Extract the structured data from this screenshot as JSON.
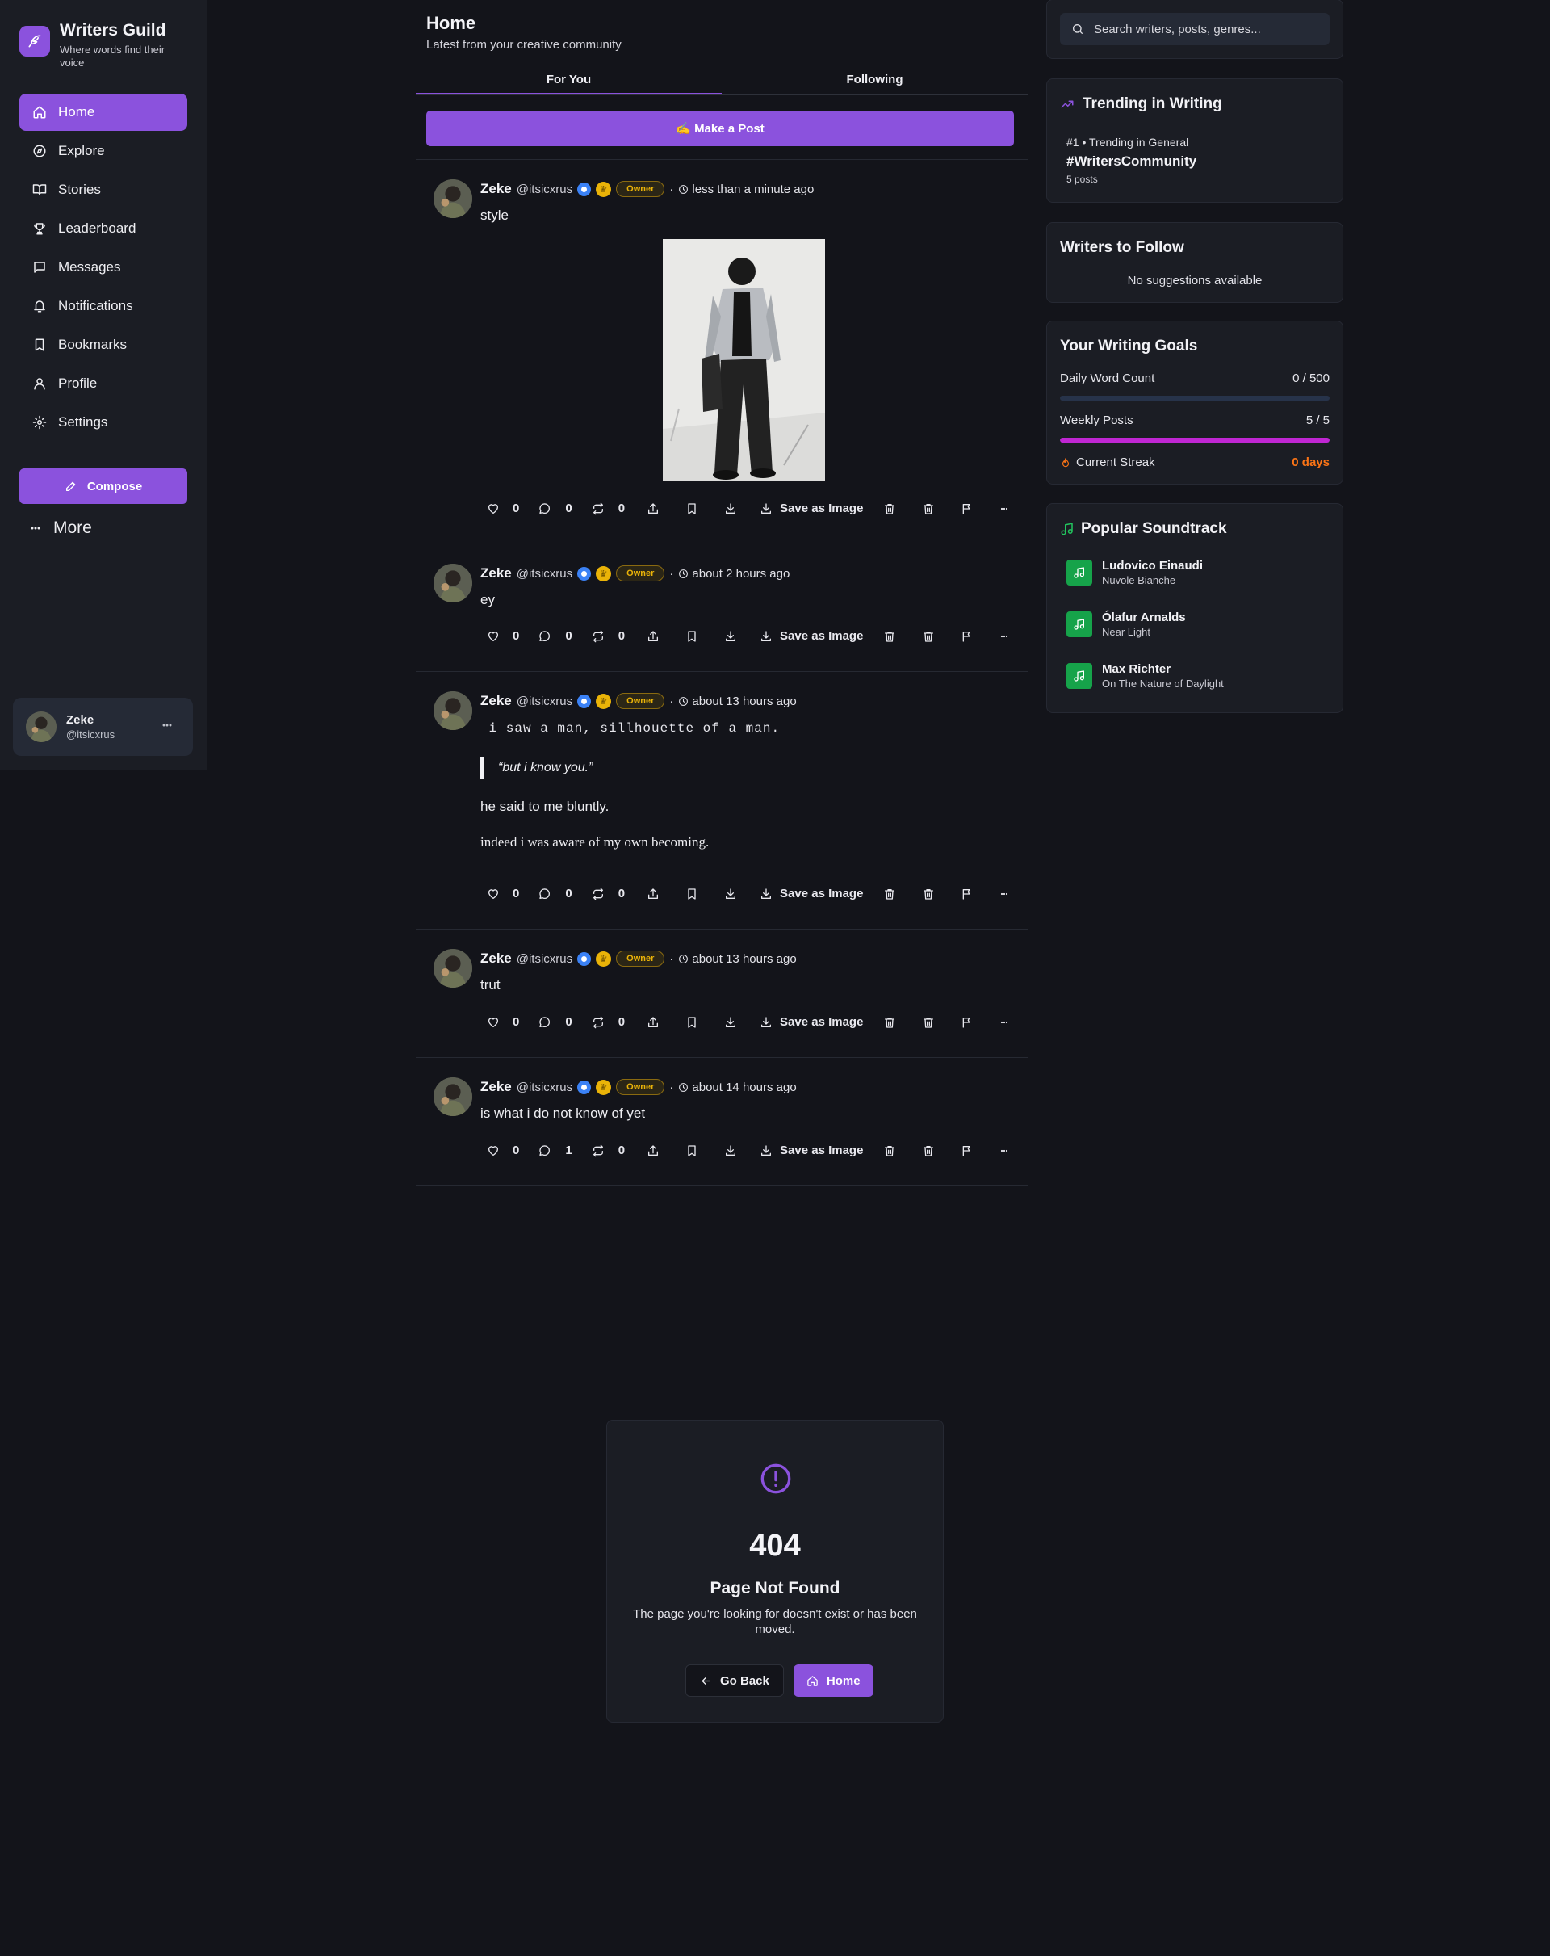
{
  "brand": {
    "name": "Writers Guild",
    "tagline": "Where words find their voice"
  },
  "nav": [
    {
      "label": "Home",
      "icon": "home-icon",
      "active": true
    },
    {
      "label": "Explore",
      "icon": "compass-icon"
    },
    {
      "label": "Stories",
      "icon": "book-icon"
    },
    {
      "label": "Leaderboard",
      "icon": "trophy-icon"
    },
    {
      "label": "Messages",
      "icon": "message-icon"
    },
    {
      "label": "Notifications",
      "icon": "bell-icon"
    },
    {
      "label": "Bookmarks",
      "icon": "bookmark-icon"
    },
    {
      "label": "Profile",
      "icon": "user-icon"
    },
    {
      "label": "Settings",
      "icon": "gear-icon"
    }
  ],
  "compose_label": "Compose",
  "more_label": "More",
  "current_user": {
    "name": "Zeke",
    "handle": "@itsicxrus"
  },
  "feed": {
    "title": "Home",
    "subtitle": "Latest from your creative community",
    "tabs": [
      "For You",
      "Following"
    ],
    "active_tab": "For You",
    "make_post_label": "✍️ Make a Post",
    "badge_label": "Owner",
    "save_label": "Save as Image"
  },
  "posts": [
    {
      "author": "Zeke",
      "handle": "@itsicxrus",
      "time": "less than a minute ago",
      "text": "style",
      "has_image": true,
      "likes": "0",
      "comments": "0",
      "reposts": "0"
    },
    {
      "author": "Zeke",
      "handle": "@itsicxrus",
      "time": "about 2 hours ago",
      "text": "ey",
      "likes": "0",
      "comments": "0",
      "reposts": "0"
    },
    {
      "author": "Zeke",
      "handle": "@itsicxrus",
      "time": "about 13 hours ago",
      "code_line": " i saw a man, sillhouette of a man.",
      "quote": "“but i know you.”",
      "line1": "he said to me bluntly.",
      "line2": "indeed i was aware of my own becoming.",
      "likes": "0",
      "comments": "0",
      "reposts": "0"
    },
    {
      "author": "Zeke",
      "handle": "@itsicxrus",
      "time": "about 13 hours ago",
      "text": "trut",
      "likes": "0",
      "comments": "0",
      "reposts": "0"
    },
    {
      "author": "Zeke",
      "handle": "@itsicxrus",
      "time": "about 14 hours ago",
      "text": "is what i do not know of yet",
      "likes": "0",
      "comments": "1",
      "reposts": "0"
    }
  ],
  "search": {
    "placeholder": "Search writers, posts, genres..."
  },
  "trending": {
    "title": "Trending in Writing",
    "rank_line": "#1 • Trending in General",
    "tag": "#WritersCommunity",
    "count": "5 posts"
  },
  "follow": {
    "title": "Writers to Follow",
    "empty": "No suggestions available"
  },
  "goals": {
    "title": "Your Writing Goals",
    "daily_label": "Daily Word Count",
    "daily_value": "0 / 500",
    "daily_progress": 0,
    "weekly_label": "Weekly Posts",
    "weekly_value": "5 / 5",
    "weekly_progress": 1,
    "streak_label": "Current Streak",
    "streak_value": "0 days"
  },
  "soundtrack": {
    "title": "Popular Soundtrack",
    "tracks": [
      {
        "artist": "Ludovico Einaudi",
        "title": "Nuvole Bianche"
      },
      {
        "artist": "Ólafur Arnalds",
        "title": "Near Light"
      },
      {
        "artist": "Max Richter",
        "title": "On The Nature of Daylight"
      }
    ]
  },
  "not_found": {
    "code": "404",
    "title": "Page Not Found",
    "message": "The page you're looking for doesn't exist or has been moved.",
    "back_label": "Go Back",
    "home_label": "Home"
  },
  "colors": {
    "accent": "#8b52dd",
    "background": "#13141a",
    "card": "#1b1d24",
    "verified": "#3b82f6",
    "owner": "#eab308",
    "streak": "#f97316",
    "music": "#16a34a",
    "weekly_bar": "#c026d3"
  }
}
